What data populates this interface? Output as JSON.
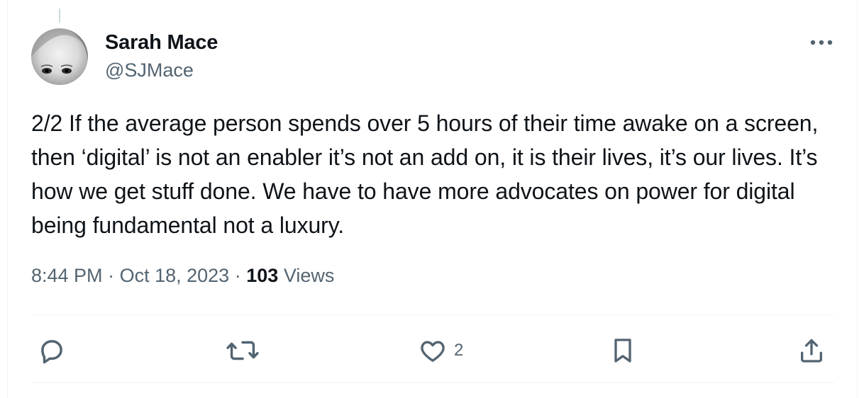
{
  "tweet": {
    "author_name": "Sarah Mace",
    "author_handle": "@SJMace",
    "text": "2/2 If the average person spends over 5 hours of their time awake on a screen, then ‘digital’ is not an enabler it’s not an add on, it is their lives, it’s our lives. It’s how we get stuff done. We have to have more advocates on power for digital being fundamental not a luxury.",
    "time": "8:44 PM",
    "separator": "·",
    "date": "Oct 18, 2023",
    "views_count": "103",
    "views_label": "Views"
  },
  "actions": {
    "reply": {
      "icon": "reply-icon",
      "count": ""
    },
    "retweet": {
      "icon": "retweet-icon",
      "count": ""
    },
    "like": {
      "icon": "heart-icon",
      "count": "2"
    },
    "bookmark": {
      "icon": "bookmark-icon",
      "count": ""
    },
    "share": {
      "icon": "share-icon",
      "count": ""
    }
  },
  "colors": {
    "text_primary": "#0f1419",
    "text_secondary": "#536471",
    "divider": "#eff3f4"
  }
}
